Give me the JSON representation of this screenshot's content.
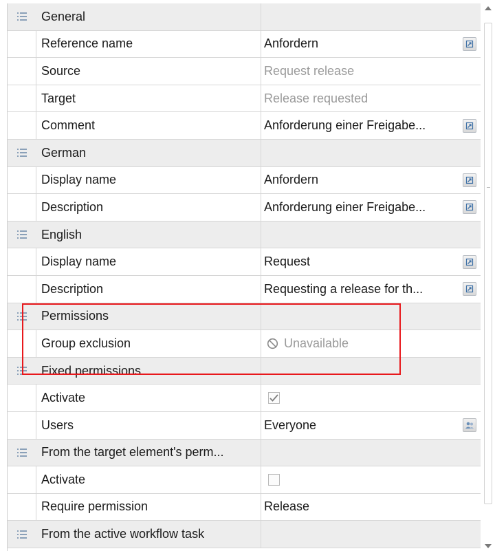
{
  "grid": {
    "sections": [
      {
        "title": "General",
        "rows": [
          {
            "name": "Reference name",
            "value": "Anfordern",
            "style": "normal",
            "control": "edit"
          },
          {
            "name": "Source",
            "value": "Request release",
            "style": "muted",
            "control": "none"
          },
          {
            "name": "Target",
            "value": "Release requested",
            "style": "muted",
            "control": "none"
          },
          {
            "name": "Comment",
            "value": "Anforderung einer Freigabe...",
            "style": "normal",
            "control": "edit"
          }
        ]
      },
      {
        "title": "German",
        "rows": [
          {
            "name": "Display name",
            "value": "Anfordern",
            "style": "normal",
            "control": "edit"
          },
          {
            "name": "Description",
            "value": "Anforderung einer Freigabe...",
            "style": "normal",
            "control": "edit"
          }
        ]
      },
      {
        "title": "English",
        "rows": [
          {
            "name": "Display name",
            "value": "Request",
            "style": "normal",
            "control": "edit"
          },
          {
            "name": "Description",
            "value": "Requesting a release for th...",
            "style": "normal",
            "control": "edit"
          }
        ]
      },
      {
        "title": "Permissions",
        "rows": [
          {
            "name": "Group exclusion",
            "value": "Unavailable",
            "style": "unavailable",
            "control": "none"
          }
        ]
      },
      {
        "title": "Fixed permissions",
        "rows": [
          {
            "name": "Activate",
            "value": "",
            "style": "checkbox",
            "checked": true,
            "control": "none"
          },
          {
            "name": "Users",
            "value": "Everyone",
            "style": "normal",
            "control": "users"
          }
        ]
      },
      {
        "title": "From the target element's perm...",
        "rows": [
          {
            "name": "Activate",
            "value": "",
            "style": "checkbox",
            "checked": false,
            "control": "none"
          },
          {
            "name": "Require permission",
            "value": "Release",
            "style": "normal",
            "control": "none"
          }
        ]
      },
      {
        "title": "From the active workflow task",
        "rows": []
      }
    ]
  },
  "icons": {
    "section": "list-icon",
    "edit": "edit-icon",
    "users": "users-icon",
    "unavailable": "unavailable-icon",
    "check": "checkmark-icon"
  },
  "colors": {
    "section_bg": "#ededed",
    "muted_text": "#9a9a9a",
    "highlight": "#e8181c"
  }
}
